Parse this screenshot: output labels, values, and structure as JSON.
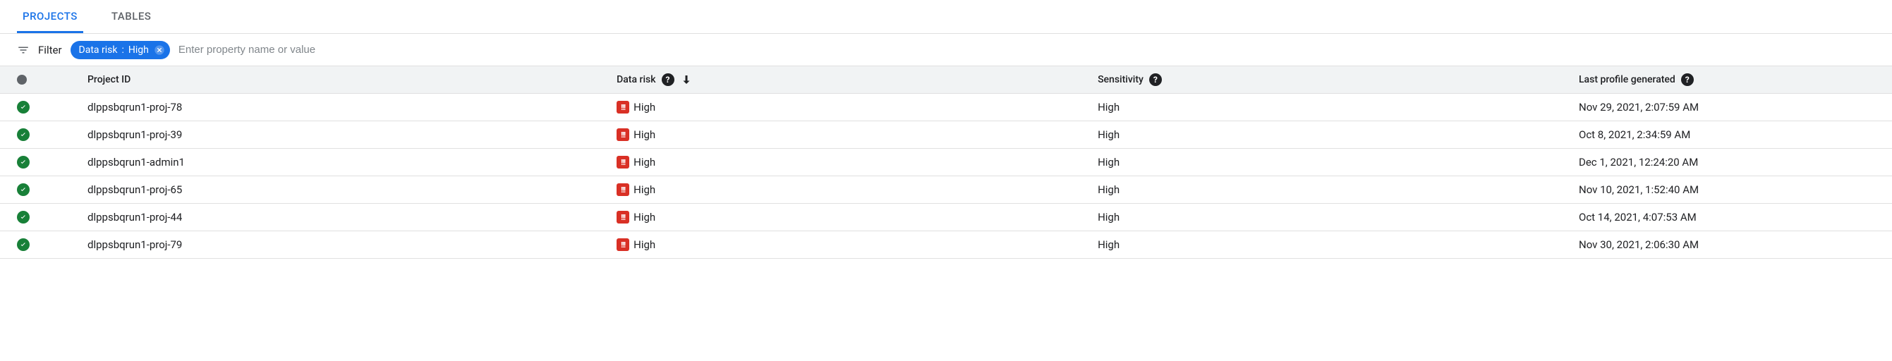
{
  "tabs": {
    "projects": "PROJECTS",
    "tables": "TABLES"
  },
  "filter": {
    "label": "Filter",
    "chip_key": "Data risk",
    "chip_sep": " : ",
    "chip_value": "High",
    "placeholder": "Enter property name or value"
  },
  "columns": {
    "project_id": "Project ID",
    "data_risk": "Data risk",
    "sensitivity": "Sensitivity",
    "last_profile": "Last profile generated"
  },
  "rows": [
    {
      "project": "dlppsbqrun1-proj-78",
      "risk": "High",
      "sensitivity": "High",
      "date": "Nov 29, 2021, 2:07:59 AM"
    },
    {
      "project": "dlppsbqrun1-proj-39",
      "risk": "High",
      "sensitivity": "High",
      "date": "Oct 8, 2021, 2:34:59 AM"
    },
    {
      "project": "dlppsbqrun1-admin1",
      "risk": "High",
      "sensitivity": "High",
      "date": "Dec 1, 2021, 12:24:20 AM"
    },
    {
      "project": "dlppsbqrun1-proj-65",
      "risk": "High",
      "sensitivity": "High",
      "date": "Nov 10, 2021, 1:52:40 AM"
    },
    {
      "project": "dlppsbqrun1-proj-44",
      "risk": "High",
      "sensitivity": "High",
      "date": "Oct 14, 2021, 4:07:53 AM"
    },
    {
      "project": "dlppsbqrun1-proj-79",
      "risk": "High",
      "sensitivity": "High",
      "date": "Nov 30, 2021, 2:06:30 AM"
    }
  ],
  "risk_badge": "!!!"
}
